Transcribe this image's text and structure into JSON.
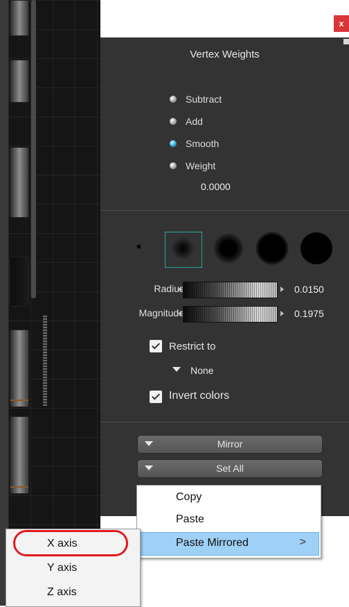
{
  "panel": {
    "title": "Vertex Weights",
    "close_label": "x",
    "modes": [
      {
        "label": "Subtract",
        "selected": false
      },
      {
        "label": "Add",
        "selected": false
      },
      {
        "label": "Smooth",
        "selected": true
      },
      {
        "label": "Weight",
        "selected": false
      }
    ],
    "weight_value": "0.0000",
    "brushes": [
      "brush-tiny",
      "brush-soft-small",
      "brush-soft-medium",
      "brush-soft-large",
      "brush-hard"
    ],
    "radius": {
      "label": "Radius",
      "value": "0.0150"
    },
    "magnitude": {
      "label": "Magnitude",
      "value": "0.1975"
    },
    "restrict_to": {
      "label": "Restrict to",
      "checked": true,
      "value": "None"
    },
    "invert_colors": {
      "label": "Invert colors",
      "checked": true
    },
    "mirror_label": "Mirror",
    "set_all_label": "Set All"
  },
  "context_menu": {
    "items": [
      {
        "label": "Copy"
      },
      {
        "label": "Paste"
      },
      {
        "label": "Paste Mirrored",
        "has_submenu": true,
        "highlighted": true
      }
    ],
    "submenu_arrow": ">"
  },
  "submenu": {
    "items": [
      {
        "label": "X axis",
        "circled": true
      },
      {
        "label": "Y axis"
      },
      {
        "label": "Z axis"
      }
    ]
  },
  "colors": {
    "panel_bg": "#333333",
    "accent_selection": "#2fa3a3",
    "highlight_ring": "#e0191f",
    "menu_highlight": "#9fd0f5"
  }
}
